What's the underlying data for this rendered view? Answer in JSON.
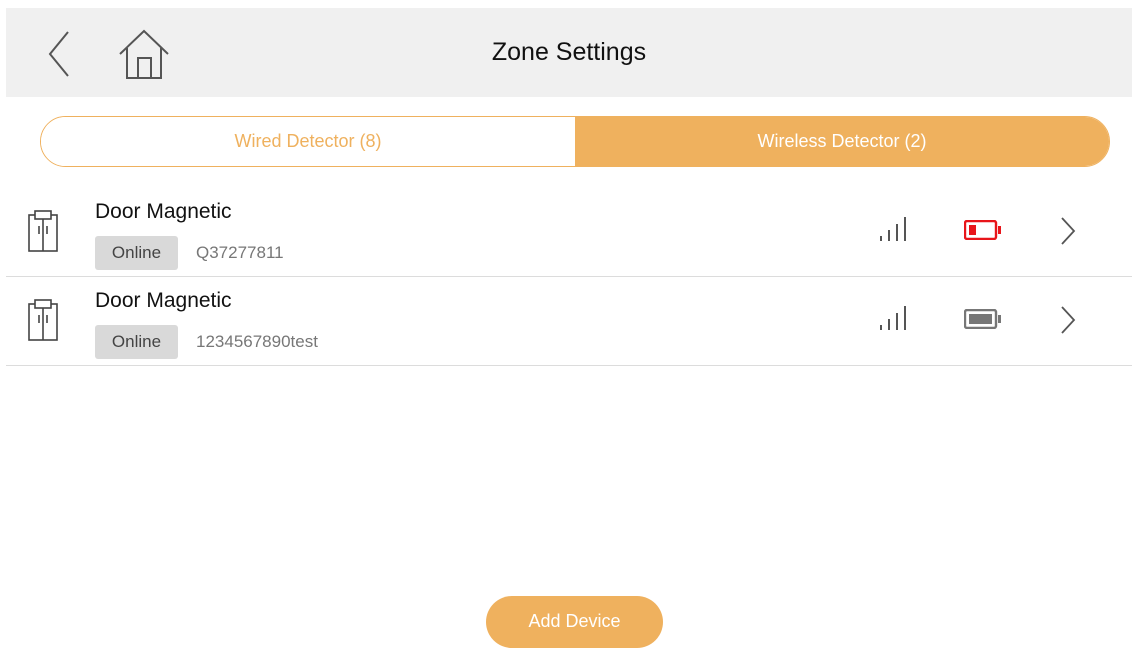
{
  "header": {
    "title": "Zone Settings",
    "back_icon": "chevron-left-icon",
    "home_icon": "home-icon"
  },
  "tabs": [
    {
      "label": "Wired Detector (8)",
      "active": false
    },
    {
      "label": "Wireless Detector (2)",
      "active": true
    }
  ],
  "devices": [
    {
      "name": "Door Magnetic",
      "status": "Online",
      "serial": "Q37277811",
      "signal_icon": "signal-icon",
      "battery_icon": "battery-low-icon",
      "battery_color": "#e8151a"
    },
    {
      "name": "Door Magnetic",
      "status": "Online",
      "serial": "1234567890test",
      "signal_icon": "signal-icon",
      "battery_icon": "battery-full-icon",
      "battery_color": "#777777"
    }
  ],
  "add_button": {
    "label": "Add Device"
  },
  "colors": {
    "accent": "#efb15e",
    "header_bg": "#f0f0f0",
    "badge_bg": "#d9d9d9"
  }
}
